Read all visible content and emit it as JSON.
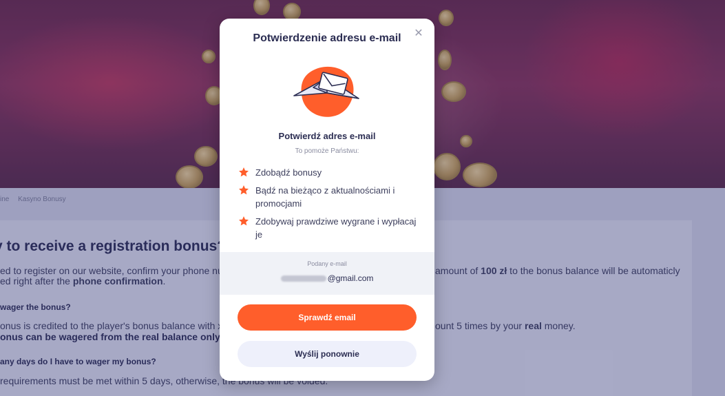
{
  "breadcrumb": {
    "items": [
      "ine",
      "Kasyno Bonusy"
    ]
  },
  "article": {
    "heading": "y to receive a registration bonus?",
    "para1_left": "ed to register on our website, confirm your phone nu",
    "para1_right_a": "amount of ",
    "para1_right_amount": "100 zł",
    "para1_right_b": " to the bonus balance will be automaticly",
    "para2_a": "ed right after the ",
    "para2_bold": "phone confirmation",
    "para2_b": ".",
    "h_wager": "wager the bonus?",
    "para3_left": "onus is credited to the player's bonus balance with x5",
    "para3_right_a": "ount 5 times by your ",
    "para3_right_bold": "real",
    "para3_right_b": " money.",
    "para4_bold": "onus can be wagered from the real balance only.",
    "h_days": "any days do I have to wager my bonus?",
    "para5": "requirements must be met within 5 days, otherwise, the bonus will be voided."
  },
  "modal": {
    "title": "Potwierdzenie adresu e-mail",
    "close_symbol": "✕",
    "illustration": "envelope-paper-plane-icon",
    "subtitle": "Potwierdź adres e-mail",
    "helper": "To pomoże Państwu:",
    "benefits": [
      "Zdobądź bonusy",
      "Bądź na bieżąco z aktualnościami i promocjami",
      "Zdobywaj prawdziwe wygrane i wypłacaj je"
    ],
    "email_label": "Podany e-mail",
    "email_domain": "@gmail.com",
    "primary_button": "Sprawdź email",
    "secondary_button": "Wyślij ponownie"
  },
  "colors": {
    "accent": "#ff5e2b",
    "title": "#2b2d52",
    "secondary_button_bg": "#eef0fb"
  }
}
